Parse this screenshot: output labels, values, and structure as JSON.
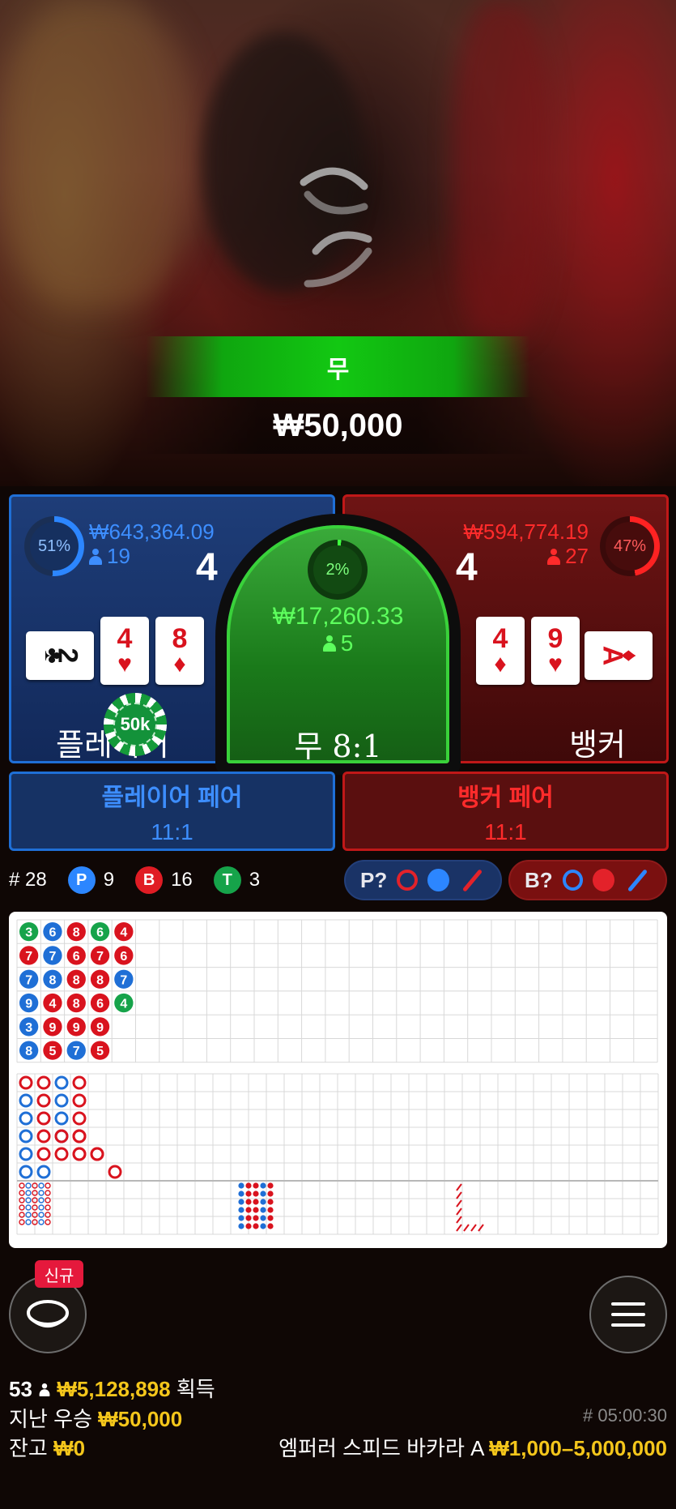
{
  "result": {
    "label": "무",
    "win_amount": "₩50,000"
  },
  "player": {
    "percent": "51%",
    "amount": "₩643,364.09",
    "players": "19",
    "score": "4",
    "label": "플레이어",
    "cards": [
      {
        "rank": "2",
        "suit": "♣",
        "color": "black",
        "orientation": "horizontal"
      },
      {
        "rank": "4",
        "suit": "♥",
        "color": "red",
        "orientation": "vertical"
      },
      {
        "rank": "8",
        "suit": "♦",
        "color": "red",
        "orientation": "vertical"
      }
    ],
    "chip": "50k"
  },
  "tie": {
    "percent": "2%",
    "amount": "₩17,260.33",
    "players": "5",
    "label": "무 8:1"
  },
  "banker": {
    "percent": "47%",
    "amount": "₩594,774.19",
    "players": "27",
    "score": "4",
    "label": "뱅커",
    "cards": [
      {
        "rank": "4",
        "suit": "♦",
        "color": "red",
        "orientation": "vertical"
      },
      {
        "rank": "9",
        "suit": "♥",
        "color": "red",
        "orientation": "vertical"
      },
      {
        "rank": "A",
        "suit": "♦",
        "color": "red",
        "orientation": "horizontal"
      }
    ]
  },
  "pairs": {
    "player": {
      "label": "플레이어 페어",
      "odds": "11:1"
    },
    "banker": {
      "label": "뱅커 페어",
      "odds": "11:1"
    }
  },
  "stats": {
    "round": "# 28",
    "player_letter": "P",
    "player_count": "9",
    "banker_letter": "B",
    "banker_count": "16",
    "tie_letter": "T",
    "tie_count": "3"
  },
  "ask": {
    "player": "P?",
    "banker": "B?"
  },
  "colors": {
    "player": "#1f6fd6",
    "banker": "#d9131e",
    "tie": "#16a34a",
    "gold": "#f4c61b"
  },
  "bead_road": [
    [
      [
        "T",
        "3"
      ],
      [
        "B",
        "7"
      ],
      [
        "P",
        "7"
      ],
      [
        "P",
        "9"
      ],
      [
        "P",
        "3"
      ],
      [
        "P",
        "8"
      ]
    ],
    [
      [
        "P",
        "6"
      ],
      [
        "P",
        "7"
      ],
      [
        "P",
        "8"
      ],
      [
        "B",
        "4"
      ],
      [
        "B",
        "9"
      ],
      [
        "B",
        "5"
      ]
    ],
    [
      [
        "B",
        "8"
      ],
      [
        "B",
        "6"
      ],
      [
        "B",
        "8"
      ],
      [
        "B",
        "8"
      ],
      [
        "B",
        "9"
      ],
      [
        "P",
        "7"
      ]
    ],
    [
      [
        "T",
        "6"
      ],
      [
        "B",
        "7"
      ],
      [
        "B",
        "8"
      ],
      [
        "B",
        "6"
      ],
      [
        "B",
        "9"
      ],
      [
        "B",
        "5"
      ]
    ],
    [
      [
        "B",
        "4"
      ],
      [
        "B",
        "6"
      ],
      [
        "P",
        "7"
      ],
      [
        "T",
        "4"
      ]
    ]
  ],
  "footer": {
    "winners": "53",
    "total_won": "₩5,128,898",
    "won_label": "획득",
    "last_win_label": "지난 우승",
    "last_win": "₩50,000",
    "balance_label": "잔고",
    "balance": "₩0",
    "game_id": "# 05:00:30",
    "table_name": "엠퍼러 스피드 바카라 A",
    "limits": "₩1,000–5,000,000",
    "new_badge": "신규"
  }
}
